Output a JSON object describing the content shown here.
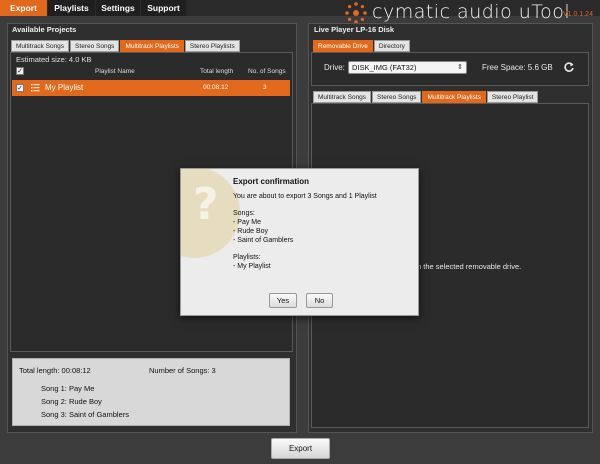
{
  "nav": {
    "tabs": [
      "Export",
      "Playlists",
      "Settings",
      "Support"
    ],
    "brand": "cymatic audio uTool",
    "version": "V1.0.1.24"
  },
  "left": {
    "title": "Available Projects",
    "tabs": [
      "Multitrack Songs",
      "Stereo Songs",
      "Multitrack Playlists",
      "Stereo Playlists"
    ],
    "estimated": "Estimated size: 4.0 KB",
    "columns": {
      "check": "✓",
      "name": "Playlist Name",
      "length": "Total length",
      "songs": "No. of Songs"
    },
    "row": {
      "check": "✓",
      "name": "My Playlist",
      "length": "00:08:12",
      "songs": "3"
    },
    "summary": {
      "total_length": "Total length:  00:08:12",
      "num_songs": "Number of Songs:  3",
      "song1": "Song 1: Pay Me",
      "song2": "Song 2: Rude Boy",
      "song3": "Song 3: Saint of Gamblers"
    }
  },
  "right": {
    "title": "Live Player LP-16 Disk",
    "top_tabs": [
      "Removable Drive",
      "Directory"
    ],
    "drive_label": "Drive:",
    "drive_value": "DISK_IMG (FAT32)",
    "free_space": "Free Space:  5.6 GB",
    "tabs": [
      "Multitrack Songs",
      "Stereo Songs",
      "Multitrack Playlists",
      "Stereo Playlist"
    ],
    "bg_message": "nt in the selected removable drive."
  },
  "dialog": {
    "title": "Export confirmation",
    "message": "You are about to export 3 Songs and 1 Playlist",
    "songs_header": "Songs:",
    "songs": [
      "- Pay Me",
      "- Rude Boy",
      "- Saint of Gamblers"
    ],
    "playlists_header": "Playlists:",
    "playlists": [
      "- My Playlist"
    ],
    "yes": "Yes",
    "no": "No"
  },
  "footer": {
    "export": "Export"
  },
  "colors": {
    "accent": "#e2691b",
    "background": "#3c3c3c"
  }
}
